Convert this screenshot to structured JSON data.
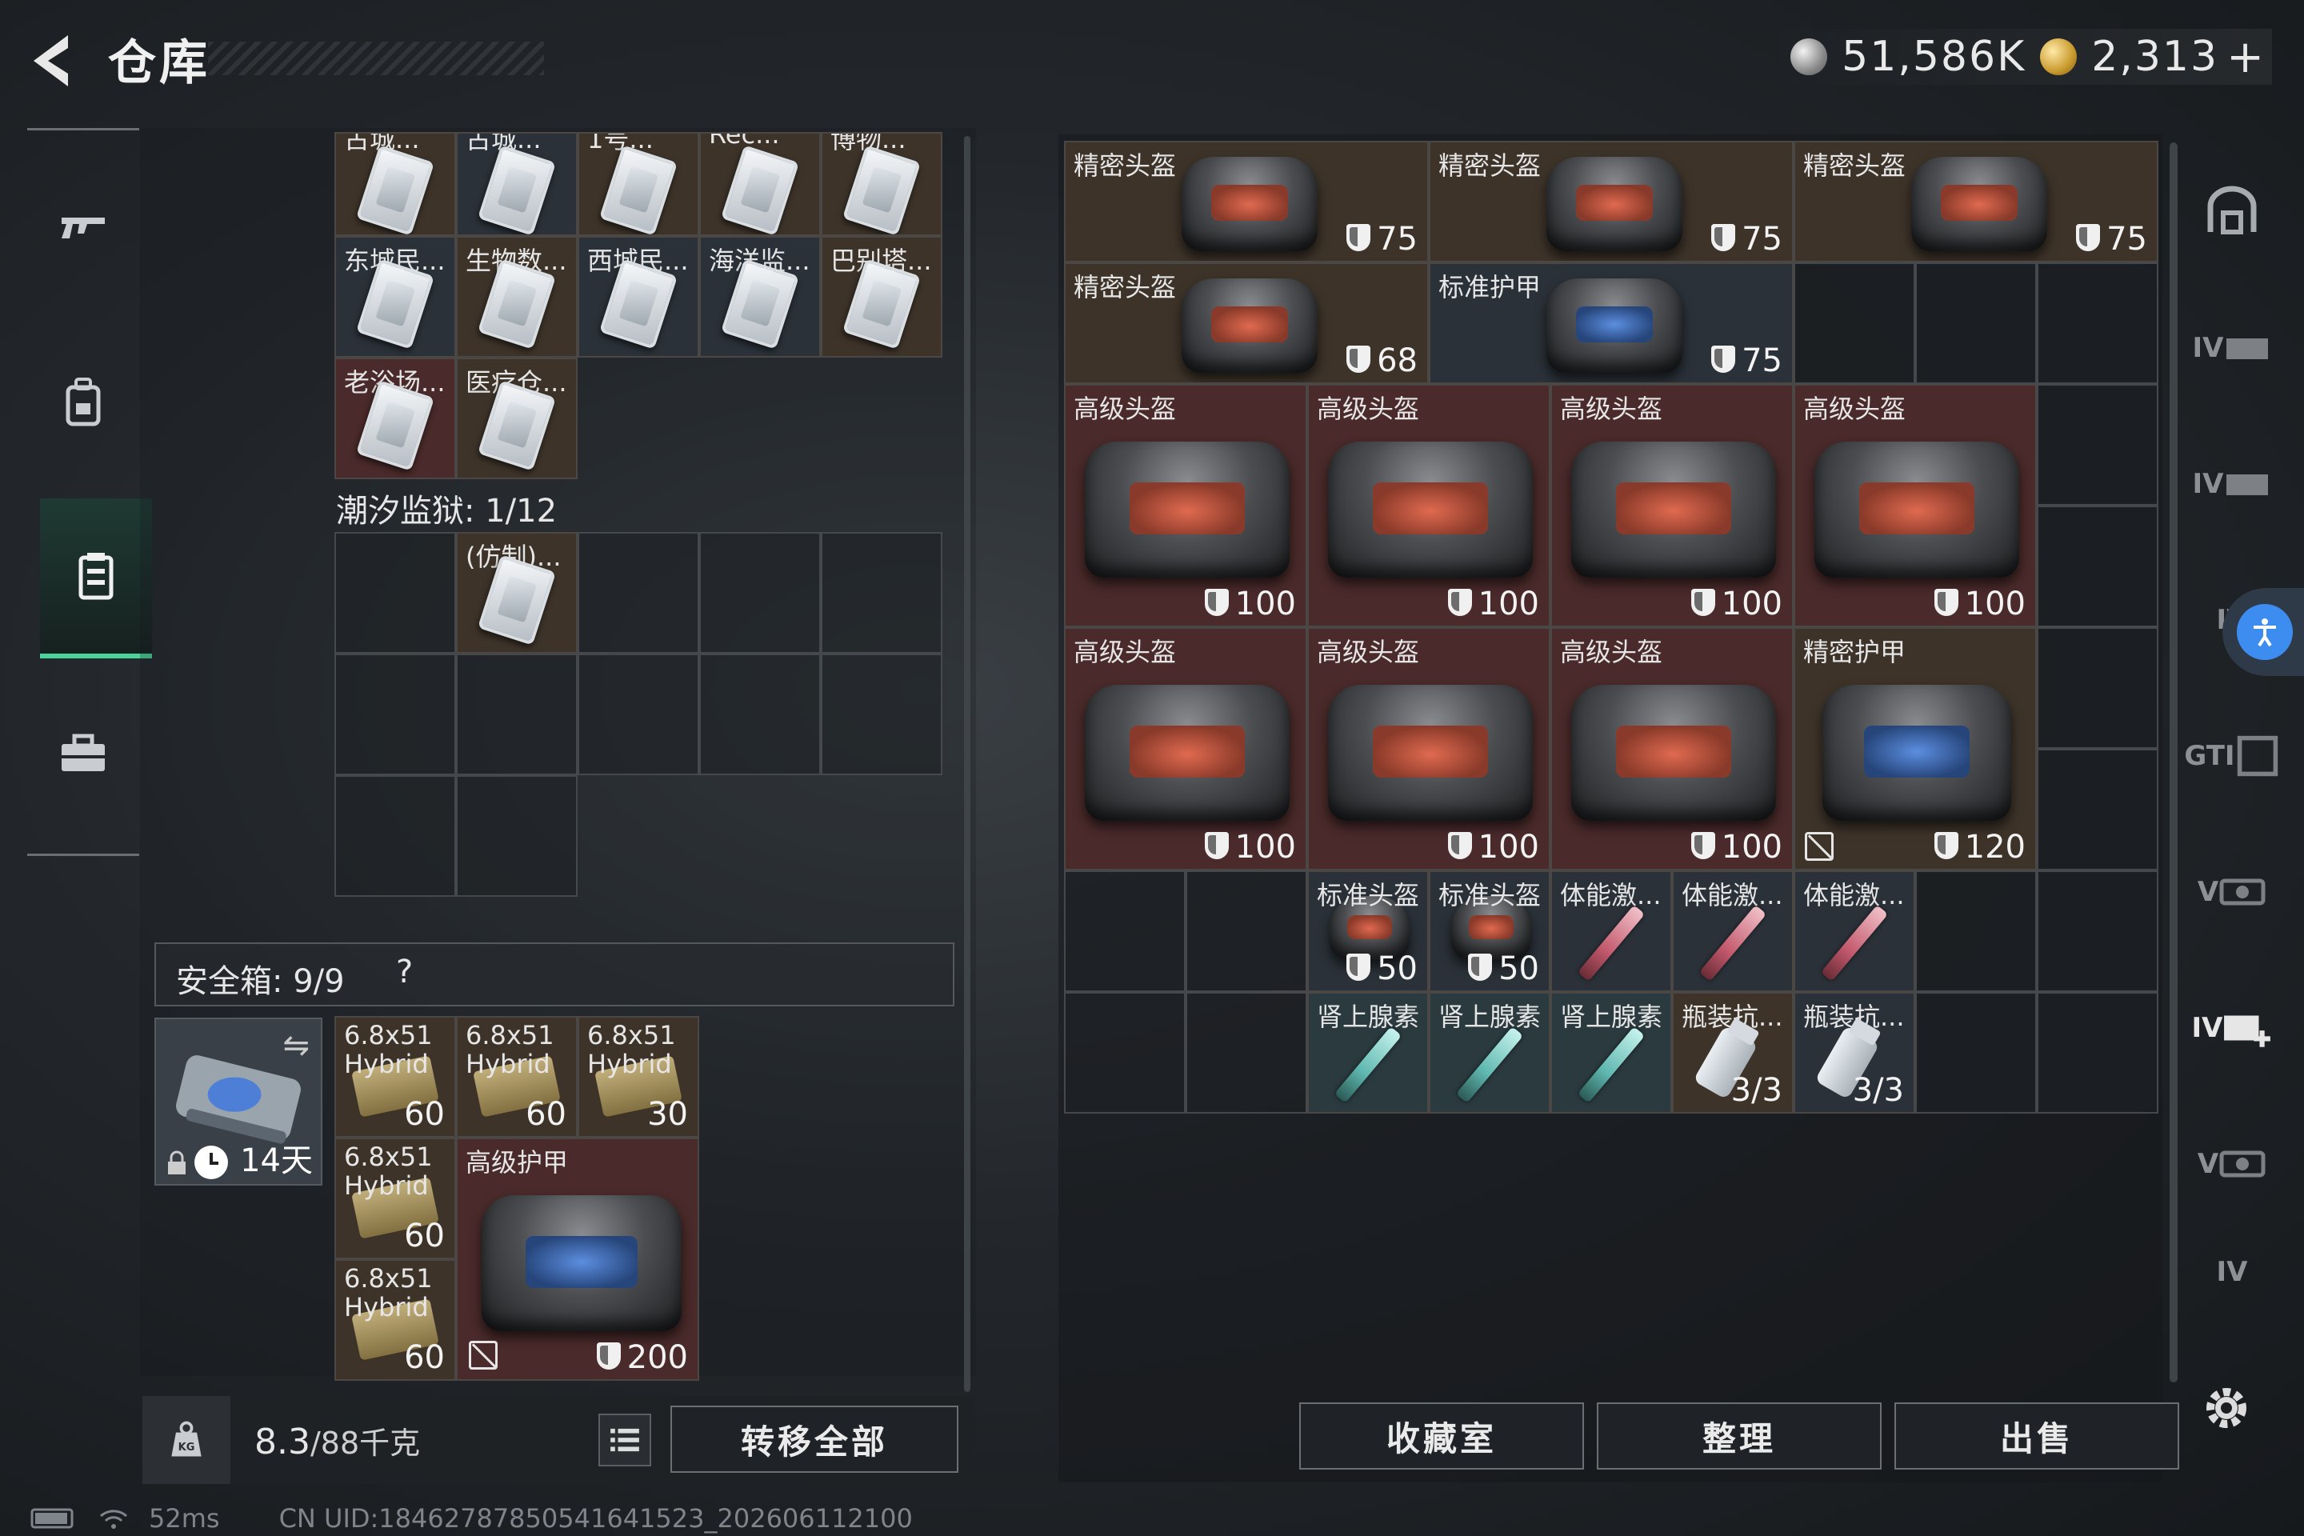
{
  "header": {
    "title": "仓库",
    "silver": "51,586K",
    "gold": "2,313",
    "plus": "+"
  },
  "left": {
    "card_rows": [
      [
        {
          "label": "古城..."
        },
        {
          "label": "古城..."
        },
        {
          "label": "1号..."
        },
        {
          "label": "Rec..."
        },
        {
          "label": "博物..."
        }
      ],
      [
        {
          "label": "东城民..."
        },
        {
          "label": "生物数..."
        },
        {
          "label": "西城民..."
        },
        {
          "label": "海洋监..."
        },
        {
          "label": "巴别塔..."
        }
      ],
      [
        {
          "label": "老浴场..."
        },
        {
          "label": "医疗仓..."
        }
      ]
    ],
    "prison_label": "潮汐监狱: 1/12",
    "prison_card_label": "(仿制)...",
    "safe_label": "安全箱: 9/9",
    "safe_help": "?",
    "safe_days": "14天",
    "safe_items": [
      {
        "label": "6.8x51 Hybrid",
        "value": "60"
      },
      {
        "label": "6.8x51 Hybrid",
        "value": "60"
      },
      {
        "label": "6.8x51 Hybrid",
        "value": "30"
      },
      {
        "label": "6.8x51 Hybrid",
        "value": "60"
      },
      {
        "label": "6.8x51 Hybrid",
        "value": "60"
      }
    ],
    "safe_armor": {
      "label": "高级护甲",
      "value": "200"
    },
    "weight": "8.3",
    "weight_cap": "/88千克",
    "transfer_all": "转移全部"
  },
  "right": {
    "row1": [
      {
        "label": "精密头盔",
        "value": "75"
      },
      {
        "label": "精密头盔",
        "value": "75"
      },
      {
        "label": "精密头盔",
        "value": "75"
      }
    ],
    "row2": [
      {
        "label": "精密头盔",
        "value": "68"
      },
      {
        "label": "标准护甲",
        "value": "75"
      }
    ],
    "big1": [
      {
        "label": "高级头盔",
        "value": "100"
      },
      {
        "label": "高级头盔",
        "value": "100"
      },
      {
        "label": "高级头盔",
        "value": "100"
      },
      {
        "label": "高级头盔",
        "value": "100"
      }
    ],
    "big2": [
      {
        "label": "高级头盔",
        "value": "100"
      },
      {
        "label": "高级头盔",
        "value": "100"
      },
      {
        "label": "高级头盔",
        "value": "100"
      },
      {
        "label": "精密护甲",
        "value": "120"
      }
    ],
    "small1": [
      {
        "label": "标准头盔",
        "value": "50"
      },
      {
        "label": "标准头盔",
        "value": "50"
      },
      {
        "label": "体能激...",
        "value": ""
      },
      {
        "label": "体能激...",
        "value": ""
      },
      {
        "label": "体能激...",
        "value": ""
      }
    ],
    "small2": [
      {
        "label": "肾上腺素",
        "value": ""
      },
      {
        "label": "肾上腺素",
        "value": ""
      },
      {
        "label": "肾上腺素",
        "value": ""
      },
      {
        "label": "瓶装抗...",
        "value": "3/3"
      },
      {
        "label": "瓶装抗...",
        "value": "3/3"
      }
    ],
    "buttons": {
      "collection": "收藏室",
      "organize": "整理",
      "sell": "出售"
    }
  },
  "right_bar": [
    "IV",
    "IV",
    "IV",
    "GTI",
    "V",
    "IV",
    "V",
    "IV"
  ],
  "status": {
    "ping": "52ms",
    "uid": "CN UID:18462787850541641523_202606112100"
  },
  "colors": {
    "accent_green": "#4ad39a",
    "accessibility_blue": "#3d8cf0"
  }
}
